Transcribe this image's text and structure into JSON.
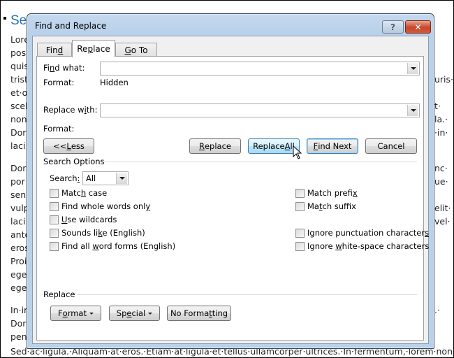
{
  "document": {
    "heading_fragment": "Se",
    "left_fragments": [
      "Lore",
      "pos",
      "quis",
      "trist",
      "et·o",
      "scel",
      "non",
      "Dor",
      "laci",
      "Dor",
      "por",
      "sen",
      "vulp",
      "laci",
      "ante",
      "eros",
      "Proi",
      "ege",
      "ege",
      "In·ir",
      "Dor",
      "pen"
    ],
    "right_fragments": [
      "uris·",
      "t·",
      "la.·",
      "·in·",
      "nc·",
      "ue·",
      "elit·",
      "vel·",
      ".·"
    ],
    "bottom_line": "Sed·ac·ligula.·Aliquam·at·eros.·Etiam·at·ligula·et·tellus·ullamcorper·ultrices.·In·fermentum,·lorem·non·"
  },
  "dialog": {
    "title": "Find and Replace",
    "help_icon": "?",
    "close_icon": "✕",
    "tabs": [
      {
        "pre": "Fin",
        "key": "d",
        "post": "",
        "active": false
      },
      {
        "pre": "Re",
        "key": "p",
        "post": "lace",
        "active": true
      },
      {
        "pre": "",
        "key": "G",
        "post": "o To",
        "active": false
      }
    ],
    "find_what": {
      "pre": "Fi",
      "key": "n",
      "post": "d what:",
      "value": ""
    },
    "find_format_label": "Format:",
    "find_format_value": "Hidden",
    "replace_with": {
      "pre": "Replace w",
      "key": "i",
      "post": "th:",
      "value": ""
    },
    "replace_format_label": "Format:",
    "buttons": {
      "less": {
        "pre": "<< ",
        "key": "L",
        "post": "ess"
      },
      "replace": {
        "pre": "",
        "key": "R",
        "post": "eplace"
      },
      "replace_all": {
        "pre": "Replace ",
        "key": "A",
        "post": "ll"
      },
      "find_next": {
        "pre": "",
        "key": "F",
        "post": "ind Next"
      },
      "cancel": "Cancel"
    },
    "search_options": {
      "title": "Search Options",
      "search_label_pre": "Search",
      "search_label_key": ":",
      "search_value": "All",
      "left_options": [
        {
          "pre": "Matc",
          "key": "h",
          "post": " case",
          "checked": false
        },
        {
          "pre": "Find whole words onl",
          "key": "y",
          "post": "",
          "checked": false
        },
        {
          "pre": "",
          "key": "U",
          "post": "se wildcards",
          "checked": false
        },
        {
          "pre": "Sounds li",
          "key": "k",
          "post": "e (English)",
          "checked": false
        },
        {
          "pre": "Find all ",
          "key": "w",
          "post": "ord forms (English)",
          "checked": false
        }
      ],
      "right_options": [
        {
          "pre": "Match prefi",
          "key": "x",
          "post": "",
          "checked": false
        },
        {
          "pre": "Ma",
          "key": "t",
          "post": "ch suffix",
          "checked": false
        },
        {
          "pre": "Ignore punctuation character",
          "key": "s",
          "post": "",
          "checked": false
        },
        {
          "pre": "Ignore ",
          "key": "w",
          "post": "hite-space characters",
          "checked": false
        }
      ]
    },
    "replace_group": {
      "title": "Replace",
      "format": {
        "pre": "F",
        "key": "o",
        "post": "rmat"
      },
      "special": {
        "pre": "Sp",
        "key": "e",
        "post": "cial"
      },
      "no_formatting": {
        "pre": "No Forma",
        "key": "t",
        "post": "ting"
      }
    }
  }
}
